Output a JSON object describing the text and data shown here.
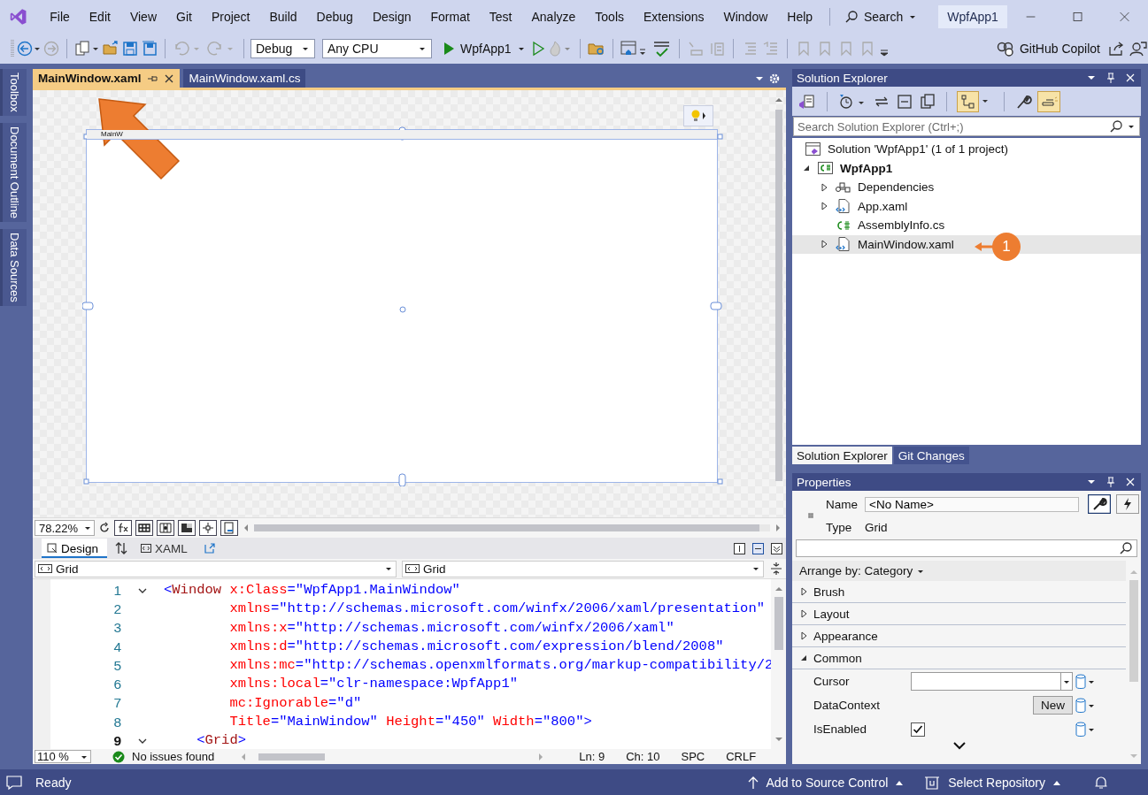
{
  "menu": [
    "File",
    "Edit",
    "View",
    "Git",
    "Project",
    "Build",
    "Debug",
    "Design",
    "Format",
    "Test",
    "Analyze",
    "Tools",
    "Extensions",
    "Window",
    "Help"
  ],
  "search": {
    "label": "Search"
  },
  "title_badge": "WpfApp1",
  "toolbar": {
    "configuration": "Debug",
    "platform": "Any CPU",
    "run_target": "WpfApp1",
    "copilot": "GitHub Copilot"
  },
  "side_tabs": [
    "Toolbox",
    "Document Outline",
    "Data Sources"
  ],
  "doc_tabs": [
    {
      "label": "MainWindow.xaml",
      "selected": true
    },
    {
      "label": "MainWindow.xaml.cs",
      "selected": false
    }
  ],
  "designer": {
    "window_title": "MainW",
    "zoom": "78.22%"
  },
  "view_tabs": [
    {
      "label": "Design",
      "selected": true
    },
    {
      "label": "XAML",
      "selected": false
    }
  ],
  "nav": [
    "Grid",
    "Grid"
  ],
  "code_lines": [
    {
      "number": "1",
      "kind": "open",
      "foldable": true,
      "current": false,
      "tokens": [
        {
          "kind": "punct",
          "text": "<"
        },
        {
          "kind": "tag",
          "text": "Window"
        },
        {
          "kind": "attr",
          "text": " x:Class"
        },
        {
          "kind": "punct",
          "text": "="
        },
        {
          "kind": "value",
          "text": "\"WpfApp1.MainWindow\""
        }
      ]
    },
    {
      "number": "2",
      "kind": "attr",
      "foldable": false,
      "current": false,
      "tokens": [
        {
          "kind": "attr",
          "text": "xmlns"
        },
        {
          "kind": "punct",
          "text": "="
        },
        {
          "kind": "value",
          "text": "\"http://schemas.microsoft.com/winfx/2006/xaml/presentation\""
        }
      ]
    },
    {
      "number": "3",
      "kind": "attr",
      "foldable": false,
      "current": false,
      "tokens": [
        {
          "kind": "attr",
          "text": "xmlns:x"
        },
        {
          "kind": "punct",
          "text": "="
        },
        {
          "kind": "value",
          "text": "\"http://schemas.microsoft.com/winfx/2006/xaml\""
        }
      ]
    },
    {
      "number": "4",
      "kind": "attr",
      "foldable": false,
      "current": false,
      "tokens": [
        {
          "kind": "attr",
          "text": "xmlns:d"
        },
        {
          "kind": "punct",
          "text": "="
        },
        {
          "kind": "value",
          "text": "\"http://schemas.microsoft.com/expression/blend/2008\""
        }
      ]
    },
    {
      "number": "5",
      "kind": "attr",
      "foldable": false,
      "current": false,
      "tokens": [
        {
          "kind": "attr",
          "text": "xmlns:mc"
        },
        {
          "kind": "punct",
          "text": "="
        },
        {
          "kind": "value",
          "text": "\"http://schemas.openxmlformats.org/markup-compatibility/2"
        }
      ]
    },
    {
      "number": "6",
      "kind": "attr",
      "foldable": false,
      "current": false,
      "tokens": [
        {
          "kind": "attr",
          "text": "xmlns:local"
        },
        {
          "kind": "punct",
          "text": "="
        },
        {
          "kind": "value",
          "text": "\"clr-namespace:WpfApp1\""
        }
      ]
    },
    {
      "number": "7",
      "kind": "attr",
      "foldable": false,
      "current": false,
      "tokens": [
        {
          "kind": "attr",
          "text": "mc:Ignorable"
        },
        {
          "kind": "punct",
          "text": "="
        },
        {
          "kind": "value",
          "text": "\"d\""
        }
      ]
    },
    {
      "number": "8",
      "kind": "attr",
      "foldable": false,
      "current": false,
      "tokens": [
        {
          "kind": "attr",
          "text": "Title"
        },
        {
          "kind": "punct",
          "text": "="
        },
        {
          "kind": "value",
          "text": "\"MainWindow\""
        },
        {
          "kind": "attr",
          "text": " Height"
        },
        {
          "kind": "punct",
          "text": "="
        },
        {
          "kind": "value",
          "text": "\"450\""
        },
        {
          "kind": "attr",
          "text": " Width"
        },
        {
          "kind": "punct",
          "text": "="
        },
        {
          "kind": "value",
          "text": "\"800\""
        },
        {
          "kind": "punct",
          "text": ">"
        }
      ]
    },
    {
      "number": "9",
      "kind": "child",
      "foldable": true,
      "current": true,
      "tokens": [
        {
          "kind": "punct",
          "text": "<"
        },
        {
          "kind": "tag",
          "text": "Grid"
        },
        {
          "kind": "punct",
          "text": ">"
        }
      ]
    }
  ],
  "editor_status": {
    "zoom": "110 %",
    "issues": "No issues found",
    "line": "Ln: 9",
    "column": "Ch: 10",
    "whitespace": "SPC",
    "line_endings": "CRLF"
  },
  "solution_explorer": {
    "title": "Solution Explorer",
    "search": {
      "placeholder": "Search Solution Explorer (Ctrl+;)"
    },
    "tree": [
      {
        "label": "Solution 'WpfApp1' (1 of 1 project)",
        "kind": "solution",
        "selected": false,
        "children": [
          {
            "label": "WpfApp1",
            "kind": "project",
            "expanded": true,
            "selected": false,
            "children": [
              {
                "label": "Dependencies",
                "kind": "dependencies",
                "expanded": false,
                "selected": false
              },
              {
                "label": "App.xaml",
                "kind": "xaml",
                "expanded": false,
                "selected": false
              },
              {
                "label": "AssemblyInfo.cs",
                "kind": "csharp",
                "selected": false
              },
              {
                "label": "MainWindow.xaml",
                "kind": "xaml",
                "expanded": false,
                "selected": true
              }
            ]
          }
        ]
      }
    ]
  },
  "callout": {
    "label": "1"
  },
  "panel_tabs": [
    {
      "label": "Solution Explorer",
      "selected": true
    },
    {
      "label": "Git Changes",
      "selected": false
    }
  ],
  "properties": {
    "title": "Properties",
    "name_label": "Name",
    "name_value": "<No Name>",
    "type_label": "Type",
    "type_value": "Grid",
    "arrange": "Arrange by: Category",
    "categories": [
      {
        "label": "Brush",
        "expanded": false
      },
      {
        "label": "Layout",
        "expanded": false
      },
      {
        "label": "Appearance",
        "expanded": false
      },
      {
        "label": "Common",
        "expanded": true,
        "properties": [
          {
            "label": "Cursor",
            "kind": "dropdown"
          },
          {
            "label": "DataContext",
            "kind": "button",
            "button": "New"
          },
          {
            "label": "IsEnabled",
            "kind": "checkbox",
            "checked": true
          }
        ]
      }
    ]
  },
  "status_bar": {
    "message": "Ready",
    "source_control": "Add to Source Control",
    "repository": "Select Repository"
  }
}
